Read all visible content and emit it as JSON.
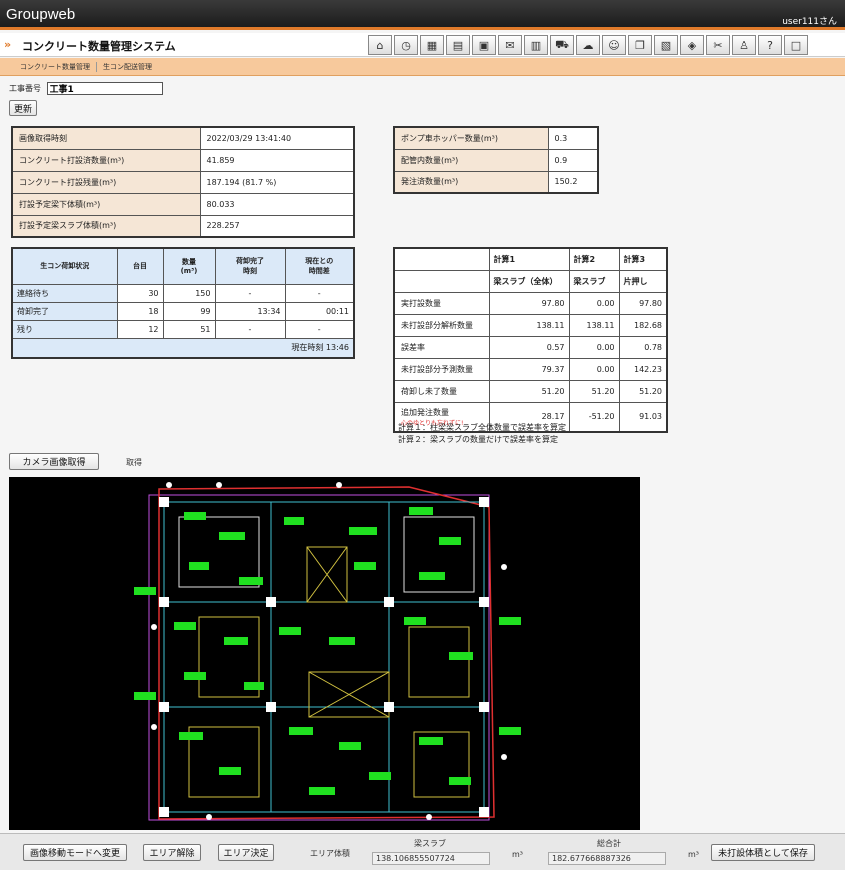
{
  "header": {
    "brand": "Groupweb",
    "user": "user111さん"
  },
  "title": "コンクリート数量管理システム",
  "subnav": [
    "コンクリート数量管理",
    "生コン配送管理"
  ],
  "construction": {
    "label": "工事番号",
    "value": "工事1"
  },
  "update_button": "更新",
  "info_left": [
    {
      "k": "画像取得時刻",
      "v": "2022/03/29 13:41:40"
    },
    {
      "k": "コンクリート打設済数量(m³)",
      "v": "41.859"
    },
    {
      "k": "コンクリート打設残量(m³)",
      "v": "187.194 (81.7 %)"
    },
    {
      "k": "打設予定梁下体積(m³)",
      "v": "80.033"
    },
    {
      "k": "打設予定梁スラブ体積(m³)",
      "v": "228.257"
    }
  ],
  "info_right": [
    {
      "k": "ポンプ車ホッパー数量(m³)",
      "v": "0.3"
    },
    {
      "k": "配管内数量(m³)",
      "v": "0.9"
    },
    {
      "k": "発注済数量(m³)",
      "v": "150.2"
    }
  ],
  "status": {
    "headers": [
      "生コン荷卸状況",
      "台目",
      "数量\n(m³)",
      "荷卸完了\n時刻",
      "現在との\n時間差"
    ],
    "rows": [
      [
        "連絡待ち",
        "30",
        "150",
        "-",
        "-"
      ],
      [
        "荷卸完了",
        "18",
        "99",
        "13:34",
        "00:11"
      ],
      [
        "残り",
        "12",
        "51",
        "-",
        "-"
      ]
    ],
    "footer": "現在時刻 13:46"
  },
  "calc": {
    "h1": [
      "",
      "計算1",
      "計算2",
      "計算3"
    ],
    "h2": [
      "",
      "梁スラブ（全体）",
      "梁スラブ",
      "片押し"
    ],
    "rows": [
      [
        "実打設数量",
        "97.80",
        "0.00",
        "97.80"
      ],
      [
        "未打設部分解析数量",
        "138.11",
        "138.11",
        "182.68"
      ],
      [
        "誤差率",
        "0.57",
        "0.00",
        "0.78"
      ],
      [
        "未打設部分予測数量",
        "79.37",
        "0.00",
        "142.23"
      ],
      [
        "荷卸し未了数量",
        "51.20",
        "51.20",
        "51.20"
      ],
      [
        "追加発注数量",
        "28.17",
        "-51.20",
        "91.03"
      ]
    ],
    "warn": "心のゆとりも忘れずに!",
    "notes": [
      "計算１：柱梁梁スラブ全体数量で誤差率を算定",
      "計算２：梁スラブの数量だけで誤差率を算定"
    ]
  },
  "camera": {
    "button": "カメラ画像取得",
    "status": "取得"
  },
  "bottom": {
    "btn_move": "画像移動モードへ変更",
    "btn_clear": "エリア解除",
    "btn_set": "エリア決定",
    "area_label": "エリア体積",
    "slab_label": "梁スラブ",
    "slab_value": "138.106855507724",
    "total_label": "総合計",
    "total_value": "182.677668887326",
    "unit": "m³",
    "save": "未打設体積として保存"
  },
  "icons": [
    "home-icon",
    "clock-icon",
    "grid-icon",
    "document-icon",
    "folder-icon",
    "mail-icon",
    "note-icon",
    "truck-icon",
    "cloud-icon",
    "user-icon",
    "copy-icon",
    "calendar-icon",
    "cube-icon",
    "tools-icon",
    "person-icon",
    "help-icon",
    "window-icon"
  ]
}
